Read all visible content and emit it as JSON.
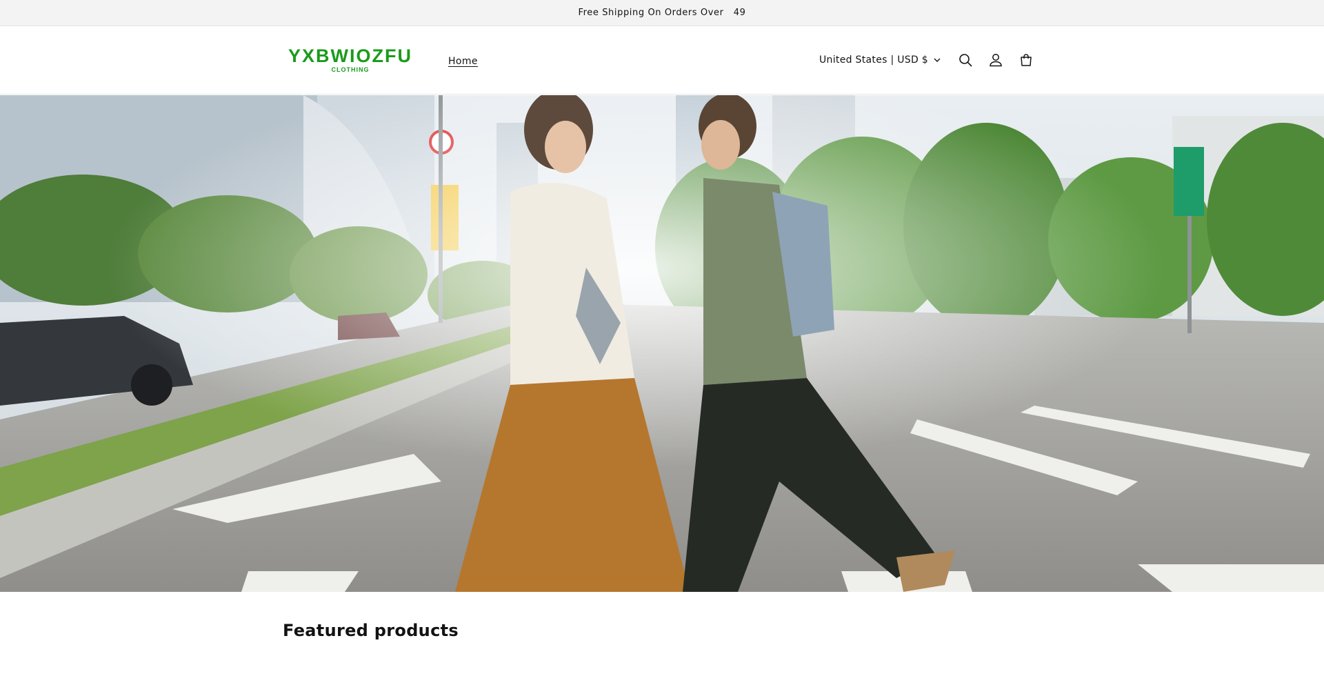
{
  "announcement": {
    "text": "Free Shipping On Orders Over   49"
  },
  "header": {
    "logo": {
      "main": "YXBWIOZFU",
      "sub": "CLOTHING"
    },
    "nav": [
      {
        "label": "Home"
      }
    ],
    "currency": {
      "label": "United States | USD $"
    },
    "icons": {
      "search": "search-icon",
      "account": "account-icon",
      "cart": "cart-icon"
    }
  },
  "hero": {
    "image": "street-couple-walking-hero"
  },
  "featured": {
    "title": "Featured products"
  },
  "colors": {
    "brand": "#1a9b1a",
    "announce_bg": "#f3f3f3",
    "text": "#121212"
  }
}
